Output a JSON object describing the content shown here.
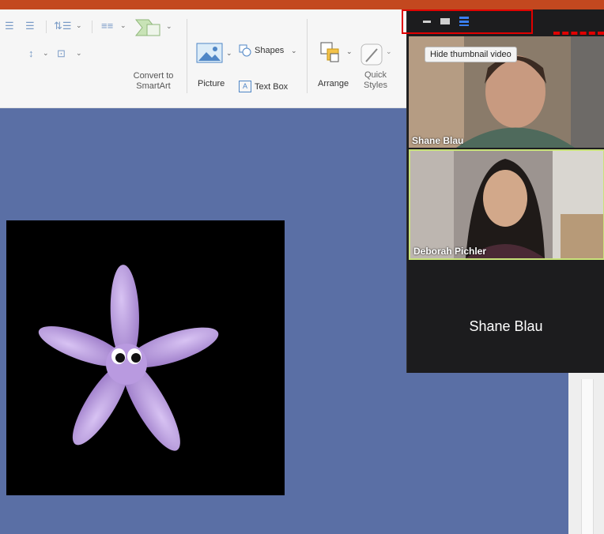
{
  "ribbon": {
    "convert_smartart_line1": "Convert to",
    "convert_smartart_line2": "SmartArt",
    "picture_label": "Picture",
    "shapes_label": "Shapes",
    "textbox_label": "Text Box",
    "arrange_label": "Arrange",
    "quick_styles_line1": "Quick",
    "quick_styles_line2": "Styles"
  },
  "zoom": {
    "tooltip": "Hide thumbnail video",
    "participants": [
      {
        "name": "Shane Blau"
      },
      {
        "name": "Deborah Pichler"
      }
    ],
    "active_speaker_name": "Shane Blau",
    "accent_color": "#3a7ff0",
    "highlight_color": "#c9e37a"
  },
  "annotation_color": "#e00000"
}
